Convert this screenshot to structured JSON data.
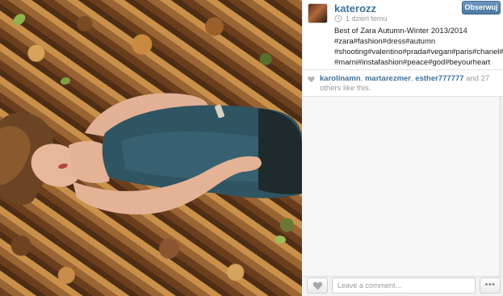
{
  "post": {
    "username": "katerozz",
    "timestamp": "1 dzień temu",
    "follow_label": "Obserwuj",
    "caption_lines": [
      "Best of Zara Autumn-Winter 2013/2014",
      "#zara#fashion#dress#autumn",
      "#shooting#valentino#prada#vegan#paris#chanel#hm",
      "#marni#instafashion#peace#god#beyourheart"
    ]
  },
  "likes": {
    "users": [
      "karolinamn",
      "martarezmer",
      "esther777777"
    ],
    "and_text": " and 27",
    "others_text": "others like this."
  },
  "footer": {
    "comment_placeholder": "Leave a comment...",
    "more_label": "•••"
  },
  "icons": {
    "like": "heart-icon",
    "timestamp": "clock-icon",
    "more": "more-dots-icon"
  },
  "colors": {
    "link": "#3f729b",
    "follow_button": "#4d7aa3",
    "muted_text": "#999999"
  }
}
